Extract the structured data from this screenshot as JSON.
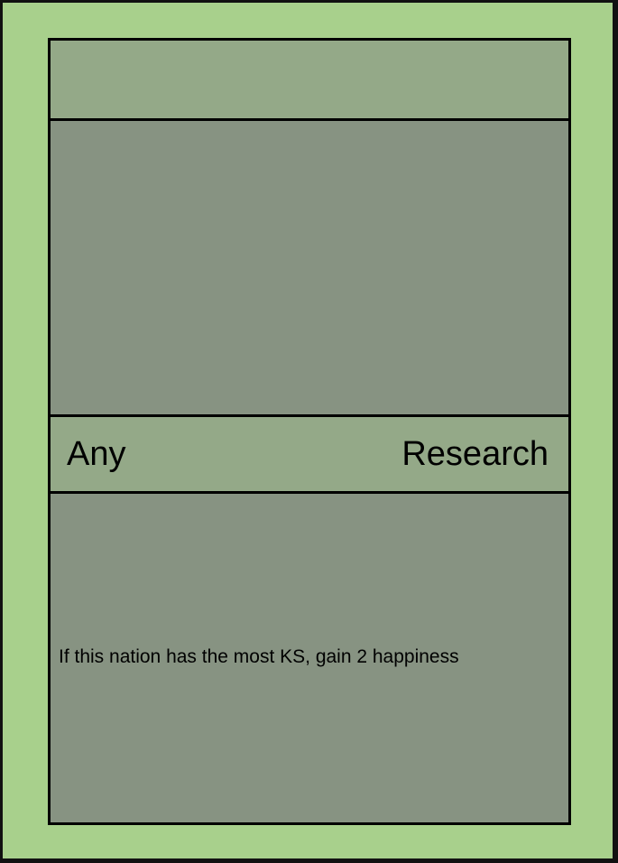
{
  "card": {
    "title": "",
    "type_left": "Any",
    "type_right": "Research",
    "rule_text": "If this nation has the most KS, gain 2 happiness"
  },
  "colors": {
    "outer_border": "#a8d08c",
    "band": "#94a988",
    "panel": "#879382",
    "outline": "#000000"
  }
}
